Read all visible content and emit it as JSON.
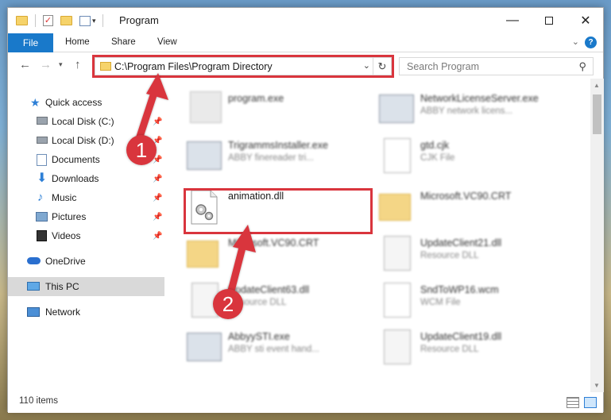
{
  "window": {
    "title": "Program"
  },
  "ribbon": {
    "tabs": [
      "File",
      "Home",
      "Share",
      "View"
    ],
    "help": "?"
  },
  "address": {
    "path": "C:\\Program Files\\Program Directory"
  },
  "search": {
    "placeholder": "Search Program"
  },
  "sidebar": {
    "items": [
      {
        "label": "Quick access",
        "icon": "star-icon"
      },
      {
        "label": "Local Disk (C:)",
        "icon": "drive-icon"
      },
      {
        "label": "Local Disk (D:)",
        "icon": "drive-icon"
      },
      {
        "label": "Documents",
        "icon": "documents-icon"
      },
      {
        "label": "Downloads",
        "icon": "download-arrow-icon"
      },
      {
        "label": "Music",
        "icon": "music-note-icon"
      },
      {
        "label": "Pictures",
        "icon": "pictures-icon"
      },
      {
        "label": "Videos",
        "icon": "film-icon"
      },
      {
        "label": "OneDrive",
        "icon": "cloud-icon"
      },
      {
        "label": "This PC",
        "icon": "monitor-icon"
      },
      {
        "label": "Network",
        "icon": "network-icon"
      }
    ]
  },
  "files": [
    {
      "name": "program.exe",
      "sub": ""
    },
    {
      "name": "NetworkLicenseServer.exe",
      "sub": "ABBY network licens..."
    },
    {
      "name": "TrigrammsInstaller.exe",
      "sub": "ABBY finereader tri..."
    },
    {
      "name": "gtd.cjk",
      "sub": "CJK File"
    },
    {
      "name": "animation.dll",
      "sub": ""
    },
    {
      "name": "Microsoft.VC90.CRT",
      "sub": ""
    },
    {
      "name": "Microsoft.VC90.CRT",
      "sub": ""
    },
    {
      "name": "UpdateClient21.dll",
      "sub": "Resource DLL"
    },
    {
      "name": "UpdateClient63.dll",
      "sub": "Resource DLL"
    },
    {
      "name": "SndToWP16.wcm",
      "sub": "WCM File"
    },
    {
      "name": "AbbyySTI.exe",
      "sub": "ABBY sti event hand..."
    },
    {
      "name": "UpdateClient19.dll",
      "sub": "Resource DLL"
    }
  ],
  "status": {
    "item_count": "110 items"
  },
  "callouts": [
    "1",
    "2"
  ],
  "colors": {
    "accent": "#1979ca",
    "highlight": "#d9353d",
    "selected": "#d9d9d9"
  }
}
